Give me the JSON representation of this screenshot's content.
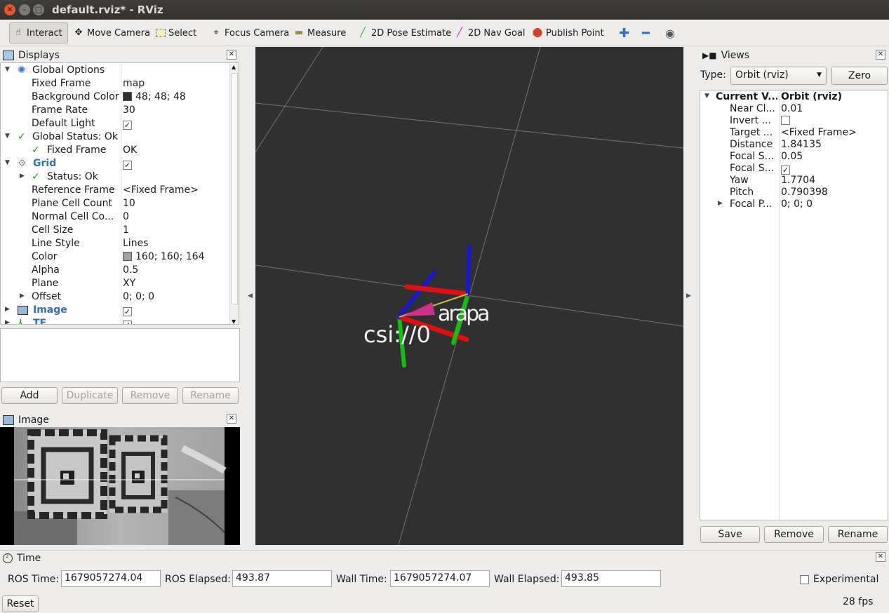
{
  "window": {
    "title": "default.rviz* - RViz"
  },
  "toolbar": {
    "tools": [
      "Interact",
      "Move Camera",
      "Select",
      "Focus Camera",
      "Measure",
      "2D Pose Estimate",
      "2D Nav Goal",
      "Publish Point"
    ],
    "active_tool": "Interact"
  },
  "displays": {
    "title": "Displays",
    "rows": [
      {
        "label": "Global Options",
        "value": ""
      },
      {
        "label": "Fixed Frame",
        "value": "map"
      },
      {
        "label": "Background Color",
        "value": "48; 48; 48"
      },
      {
        "label": "Frame Rate",
        "value": "30"
      },
      {
        "label": "Default Light",
        "value": ""
      },
      {
        "label": "Global Status: Ok",
        "value": ""
      },
      {
        "label": "Fixed Frame",
        "value": "OK"
      },
      {
        "label": "Grid",
        "value": ""
      },
      {
        "label": "Status: Ok",
        "value": ""
      },
      {
        "label": "Reference Frame",
        "value": "<Fixed Frame>"
      },
      {
        "label": "Plane Cell Count",
        "value": "10"
      },
      {
        "label": "Normal Cell Co...",
        "value": "0"
      },
      {
        "label": "Cell Size",
        "value": "1"
      },
      {
        "label": "Line Style",
        "value": "Lines"
      },
      {
        "label": "Color",
        "value": "160; 160; 164"
      },
      {
        "label": "Alpha",
        "value": "0.5"
      },
      {
        "label": "Plane",
        "value": "XY"
      },
      {
        "label": "Offset",
        "value": "0; 0; 0"
      },
      {
        "label": "Image",
        "value": ""
      },
      {
        "label": "TF",
        "value": ""
      }
    ],
    "buttons": {
      "add": "Add",
      "duplicate": "Duplicate",
      "remove": "Remove",
      "rename": "Rename"
    },
    "colors": {
      "background": "#303030",
      "grid": "#a0a0a4"
    }
  },
  "image_panel": {
    "title": "Image"
  },
  "viewport": {
    "labels": {
      "frame_a": "csi://0",
      "frame_b": "arapa"
    }
  },
  "views": {
    "title": "Views",
    "type_label": "Type:",
    "type_value": "Orbit (rviz)",
    "zero_button": "Zero",
    "rows": [
      {
        "label": "Current V...",
        "value": "Orbit (rviz)"
      },
      {
        "label": "Near Cl...",
        "value": "0.01"
      },
      {
        "label": "Invert ...",
        "value": ""
      },
      {
        "label": "Target ...",
        "value": "<Fixed Frame>"
      },
      {
        "label": "Distance",
        "value": "1.84135"
      },
      {
        "label": "Focal S...",
        "value": "0.05"
      },
      {
        "label": "Focal S...",
        "value": ""
      },
      {
        "label": "Yaw",
        "value": "1.7704"
      },
      {
        "label": "Pitch",
        "value": "0.790398"
      },
      {
        "label": "Focal P...",
        "value": "0; 0; 0"
      }
    ],
    "buttons": {
      "save": "Save",
      "remove": "Remove",
      "rename": "Rename"
    }
  },
  "time": {
    "title": "Time",
    "ros_time_label": "ROS Time:",
    "ros_time": "1679057274.04",
    "ros_elapsed_label": "ROS Elapsed:",
    "ros_elapsed": "493.87",
    "wall_time_label": "Wall Time:",
    "wall_time": "1679057274.07",
    "wall_elapsed_label": "Wall Elapsed:",
    "wall_elapsed": "493.85",
    "experimental_label": "Experimental",
    "reset_button": "Reset",
    "fps": "28 fps"
  }
}
